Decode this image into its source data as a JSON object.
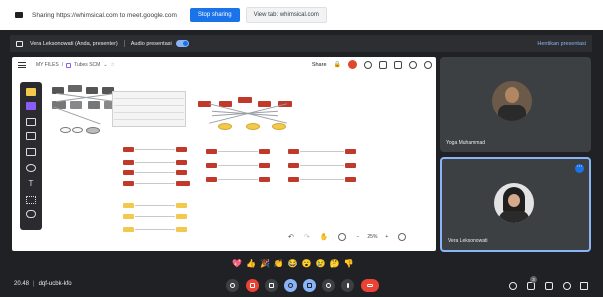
{
  "share_bar": {
    "message": "Sharing https://whimsical.com to meet.google.com",
    "stop_label": "Stop sharing",
    "view_tab_label": "View tab: whimsical.com"
  },
  "presenter_bar": {
    "presenter": "Vera Leksonowati (Anda, presenter)",
    "audio_label": "Audio presentasi",
    "stop_label": "Hentikan presentasi"
  },
  "board": {
    "breadcrumb_root": "MY FILES",
    "file_name": "Tubes SCM",
    "share_label": "Share",
    "zoom_level": "25%"
  },
  "participants": [
    {
      "name": "Yoga Muhammad"
    },
    {
      "name": "Vera Leksonowati"
    }
  ],
  "reactions": [
    "💖",
    "👍",
    "🎉",
    "👏",
    "😂",
    "😮",
    "😢",
    "🤔",
    "👎"
  ],
  "meeting": {
    "time": "20.48",
    "code": "dqf-ucbk-kfo",
    "participant_count": "3"
  },
  "icons": {
    "share_screen": "screen-share-icon",
    "menu": "hamburger-menu-icon",
    "mic": "mic-icon",
    "camera": "camera-icon",
    "leave": "leave-call-icon"
  },
  "colors": {
    "accent": "#1a73e8",
    "leave": "#ea4335",
    "whimsical_purple": "#8b5cf6",
    "node_red": "#c0392b",
    "node_yellow": "#f2c94c"
  }
}
